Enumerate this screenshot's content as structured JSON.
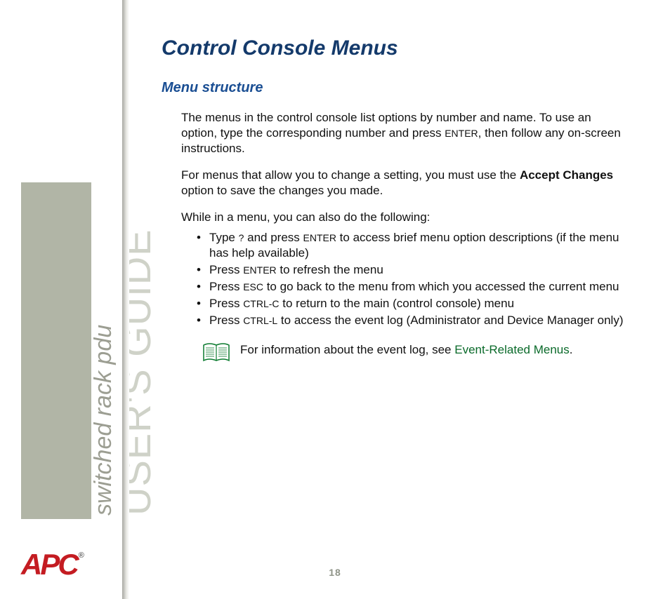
{
  "sidebar": {
    "title_large": "USER'S GUIDE",
    "title_small": "switched rack pdu"
  },
  "logo": {
    "text": "APC",
    "tm": "®"
  },
  "page_number": "18",
  "content": {
    "h1": "Control Console Menus",
    "h2": "Menu structure",
    "para1_a": "The menus in the control console list options by number and name. To use an option, type the corresponding number and press ",
    "para1_enter": "ENTER",
    "para1_b": ", then follow any on-screen instructions.",
    "para2_a": "For menus that allow you to change a setting, you must use the ",
    "para2_bold": "Accept Changes",
    "para2_b": " option to save the changes you made.",
    "para3": "While in a menu, you can also do the following:",
    "bullets": {
      "b1_a": "Type ",
      "b1_q": "?",
      "b1_b": " and press ",
      "b1_enter": "ENTER",
      "b1_c": " to access brief menu option descriptions (if the menu has help available)",
      "b2_a": "Press ",
      "b2_enter": "ENTER",
      "b2_b": " to refresh the menu",
      "b3_a": "Press ",
      "b3_esc": "ESC",
      "b3_b": " to go back to the menu from which you accessed the current menu",
      "b4_a": "Press ",
      "b4_ctrlc": "CTRL-C",
      "b4_b": " to return to the main (control console) menu",
      "b5_a": "Press ",
      "b5_ctrll": "CTRL-L",
      "b5_b": " to access the event log (Administrator and Device Manager only)"
    },
    "note_a": "For information about the event log, see ",
    "note_link": "Event-Related Menus",
    "note_b": "."
  }
}
